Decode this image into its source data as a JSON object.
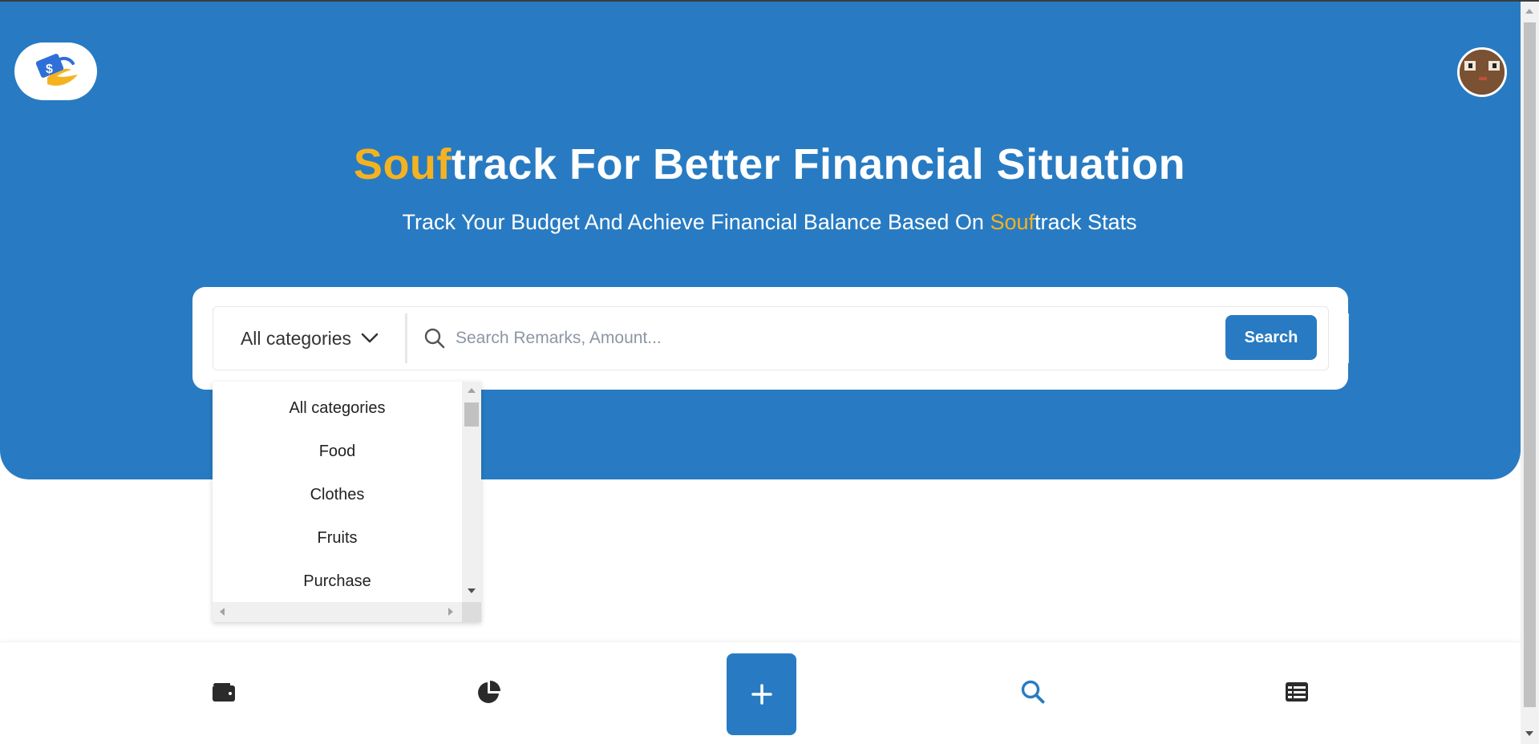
{
  "hero": {
    "title_accent": "Souf",
    "title_rest": "track For Better Financial Situation",
    "subtitle_pre": "Track Your Budget And Achieve Financial Balance Based On ",
    "subtitle_accent": "Souf",
    "subtitle_post": "track Stats"
  },
  "search": {
    "category_selected": "All categories",
    "placeholder": "Search Remarks, Amount...",
    "button_label": "Search"
  },
  "dropdown": {
    "options": [
      "All categories",
      "Food",
      "Clothes",
      "Fruits",
      "Purchase"
    ]
  },
  "bottom_nav": {
    "items": [
      "wallet-icon",
      "pie-chart-icon",
      "plus-icon",
      "search-icon",
      "list-icon"
    ],
    "active": "search-icon"
  },
  "colors": {
    "primary": "#287bc2",
    "accent": "#f5b220",
    "white": "#ffffff"
  }
}
